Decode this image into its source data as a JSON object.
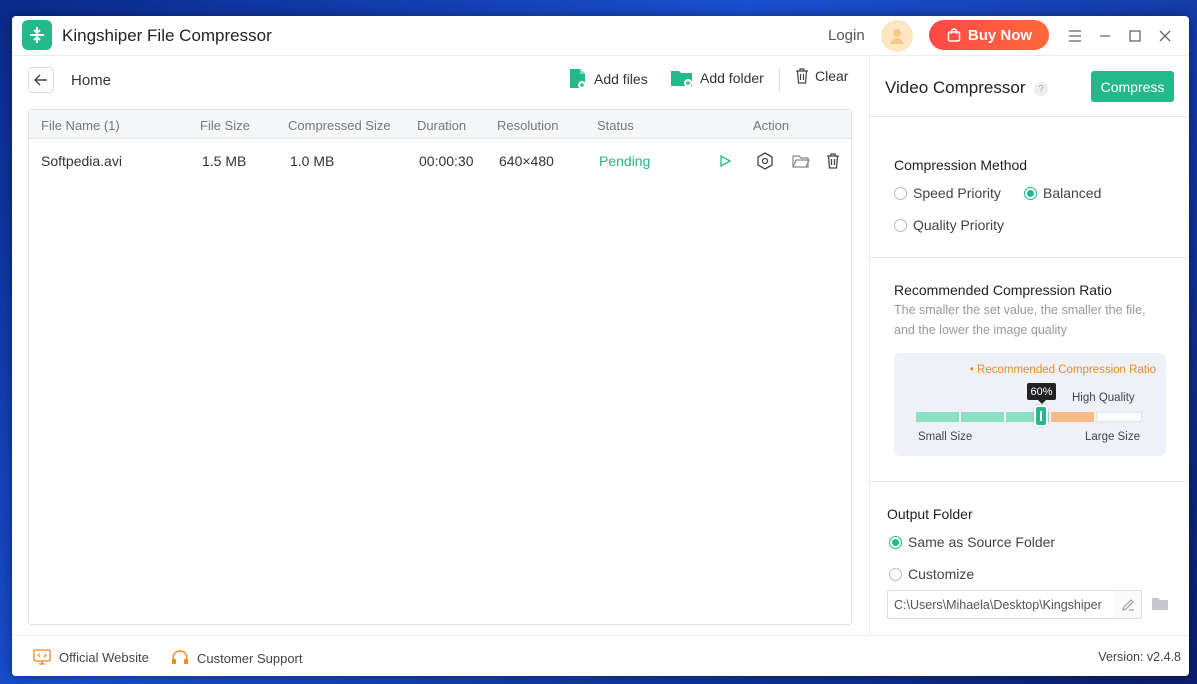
{
  "app": {
    "title": "Kingshiper File Compressor",
    "login_label": "Login",
    "buy_label": "Buy Now"
  },
  "toolbar": {
    "home_label": "Home",
    "add_files_label": "Add files",
    "add_folder_label": "Add folder",
    "clear_label": "Clear"
  },
  "table": {
    "columns": {
      "file_name": "File Name  (1)",
      "file_size": "File Size",
      "compressed_size": "Compressed Size",
      "duration": "Duration",
      "resolution": "Resolution",
      "status": "Status",
      "action": "Action"
    },
    "rows": [
      {
        "file_name": "Softpedia.avi",
        "file_size": "1.5 MB",
        "compressed_size": "1.0 MB",
        "duration": "00:00:30",
        "resolution": "640×480",
        "status": "Pending"
      }
    ]
  },
  "panel": {
    "title": "Video Compressor",
    "help_glyph": "?",
    "compress_label": "Compress",
    "method": {
      "title": "Compression Method",
      "options": [
        "Speed Priority",
        "Balanced",
        "Quality Priority"
      ],
      "selected": "Balanced"
    },
    "ratio": {
      "title": "Recommended Compression Ratio",
      "description": "The smaller the set value, the smaller the file, and the lower the image quality",
      "recommended_label": "• Recommended Compression Ratio",
      "high_quality_label": "High Quality",
      "value_label": "60%",
      "value": 0.6,
      "small_label": "Small Size",
      "large_label": "Large Size"
    },
    "output": {
      "title": "Output Folder",
      "options": [
        "Same as Source Folder",
        "Customize"
      ],
      "selected": "Same as Source Folder",
      "path": "C:\\Users\\Mihaela\\Desktop\\Kingshiper"
    }
  },
  "footer": {
    "official_website": "Official Website",
    "customer_support": "Customer Support",
    "version": "Version: v2.4.8"
  },
  "colors": {
    "accent": "#23b98a",
    "buy": "#ff4848",
    "recommended": "#f08a1e"
  }
}
